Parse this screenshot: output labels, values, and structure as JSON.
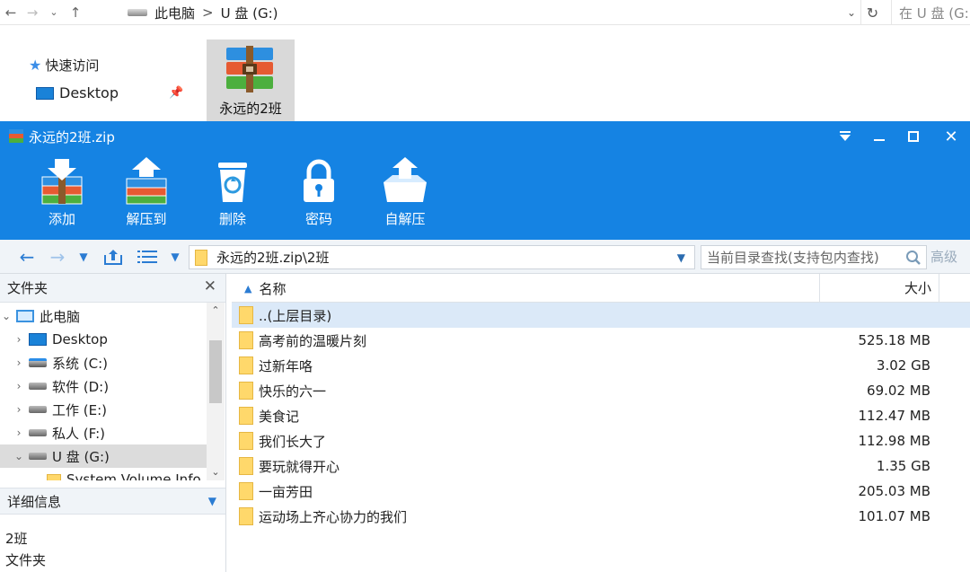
{
  "explorer": {
    "breadcrumb": [
      "此电脑",
      "U 盘 (G:)"
    ],
    "search_placeholder": "在 U 盘 (G:)",
    "quick_access": "快速访问",
    "desktop": "Desktop",
    "selected_file": "永远的2班"
  },
  "archive_window": {
    "title": "永远的2班.zip",
    "toolbar": [
      {
        "label": "添加",
        "icon": "add-archive-icon"
      },
      {
        "label": "解压到",
        "icon": "extract-to-icon"
      },
      {
        "label": "删除",
        "icon": "delete-icon"
      },
      {
        "label": "密码",
        "icon": "password-lock-icon"
      },
      {
        "label": "自解压",
        "icon": "self-extract-icon"
      }
    ],
    "path": "永远的2班.zip\\2班",
    "search_placeholder": "当前目录查找(支持包内查找)",
    "advanced": "高级",
    "folder_pane": {
      "header": "文件夹",
      "tree": [
        {
          "label": "此电脑",
          "icon": "computer-icon"
        },
        {
          "label": "Desktop",
          "icon": "desktop-icon"
        },
        {
          "label": "系统 (C:)",
          "icon": "system-drive-icon"
        },
        {
          "label": "软件 (D:)",
          "icon": "drive-icon"
        },
        {
          "label": "工作 (E:)",
          "icon": "drive-icon"
        },
        {
          "label": "私人 (F:)",
          "icon": "drive-icon"
        },
        {
          "label": "U 盘 (G:)",
          "icon": "drive-icon"
        },
        {
          "label": "System Volume Info",
          "icon": "folder-icon"
        }
      ]
    },
    "details": {
      "header": "详细信息",
      "name": "2班",
      "type": "文件夹"
    },
    "list": {
      "columns": {
        "name": "名称",
        "size": "大小"
      },
      "rows": [
        {
          "name": "..(上层目录)",
          "size": ""
        },
        {
          "name": "高考前的温暖片刻",
          "size": "525.18 MB"
        },
        {
          "name": "过新年咯",
          "size": "3.02 GB"
        },
        {
          "name": "快乐的六一",
          "size": "69.02 MB"
        },
        {
          "name": "美食记",
          "size": "112.47 MB"
        },
        {
          "name": "我们长大了",
          "size": "112.98 MB"
        },
        {
          "name": "要玩就得开心",
          "size": "1.35 GB"
        },
        {
          "name": "一亩芳田",
          "size": "205.03 MB"
        },
        {
          "name": "运动场上齐心协力的我们",
          "size": "101.07 MB"
        }
      ]
    }
  },
  "colors": {
    "accent": "#1583e3",
    "folder": "#ffd86b",
    "selection": "#dbe9f8"
  }
}
